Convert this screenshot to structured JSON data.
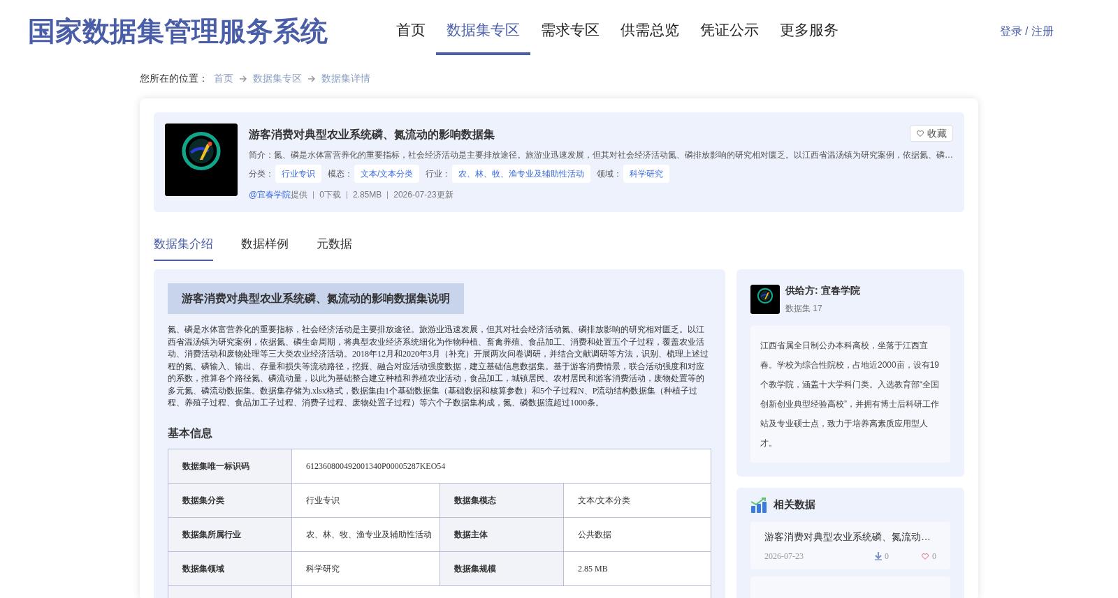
{
  "header": {
    "site_title": "国家数据集管理服务系统",
    "nav": [
      {
        "label": "首页",
        "selected": false
      },
      {
        "label": "数据集专区",
        "selected": true
      },
      {
        "label": "需求专区",
        "selected": false
      },
      {
        "label": "供需总览",
        "selected": false
      },
      {
        "label": "凭证公示",
        "selected": false
      },
      {
        "label": "更多服务",
        "selected": false
      }
    ],
    "login": "登录 / 注册"
  },
  "breadcrumb": {
    "label": "您所在的位置：",
    "items": [
      "首页",
      "数据集专区",
      "数据集详情"
    ]
  },
  "dataset": {
    "title": "游客消费对典型农业系统磷、氮流动的影响数据集",
    "favorite": "收藏",
    "summary": "简介：氮、磷是水体富营养化的重要指标，社会经济活动是主要排放途径。旅游业迅速发展，但其对社会经济活动氮、磷排放影响的研究相对匮乏。以江西省温汤镇为研究案例，依据氮、磷…",
    "tags": [
      {
        "label": "分类：",
        "value": "行业专识"
      },
      {
        "label": "模态：",
        "value": "文本/文本分类"
      },
      {
        "label": "行业：",
        "value": "农、林、牧、渔专业及辅助性活动"
      },
      {
        "label": "领域：",
        "value": "科学研究"
      }
    ],
    "provider": "@宜春学院",
    "provider_suffix": "提供",
    "meta": [
      "0下载",
      "2.85MB",
      "2026-07-23更新"
    ]
  },
  "tabs": [
    {
      "label": "数据集介绍",
      "selected": true
    },
    {
      "label": "数据样例",
      "selected": false
    },
    {
      "label": "元数据",
      "selected": false
    }
  ],
  "description": {
    "heading": "游客消费对典型农业系统磷、氮流动的影响数据集说明",
    "body": "氮、磷是水体富营养化的重要指标，社会经济活动是主要排放途径。旅游业迅速发展，但其对社会经济活动氮、磷排放影响的研究相对匮乏。以江西省温汤镇为研究案例，依据氮、磷生命周期，将典型农业经济系统细化为作物种植、畜禽养殖、食品加工、消费和处置五个子过程，覆盖农业活动、消费活动和废物处理等三大类农业经济活动。2018年12月和2020年3月（补充）开展两次问卷调研，并结合文献调研等方法，识别、梳理上述过程的氮、磷输入、输出、存量和损失等流动路径，挖掘、融合对应活动强度数据，建立基础信息数据集。基于游客消费情景，联合活动强度和对应的系数，推算各个路径氮、磷流动量，以此为基础整合建立种植和养殖农业活动，食品加工，城镇居民、农村居民和游客消费活动，废物处置等的多元氮、磷流动数据集。数据集存储为.xlsx格式，数据集由1个基础数据集（基础数据和核算参数）和5个子过程N、P流动结构数据集（种植子过程、养殖子过程、食品加工子过程、消费子过程、废物处置子过程）等六个子数据集构成，氮、磷数据流超过1000条。"
  },
  "basic_info": {
    "heading": "基本信息",
    "rows": [
      [
        {
          "label": "数据集唯一标识码",
          "value": "612360800492001340P00005287KEO54"
        }
      ],
      [
        {
          "label": "数据集分类",
          "value": "行业专识"
        },
        {
          "label": "数据集模态",
          "value": "文本/文本分类"
        }
      ],
      [
        {
          "label": "数据集所属行业",
          "value": "农、林、牧、渔专业及辅助性活动"
        },
        {
          "label": "数据主体",
          "value": "公共数据"
        }
      ],
      [
        {
          "label": "数据集领域",
          "value": "科学研究"
        },
        {
          "label": "数据集规模",
          "value": "2.85 MB"
        }
      ]
    ]
  },
  "supplier": {
    "name": "供给方: 宜春学院",
    "count": "数据集 17",
    "intro": "江西省属全日制公办本科高校，坐落于江西宜春。学校为综合性院校，占地近2000亩，设有19个教学院，涵盖十大学科门类。入选教育部“全国创新创业典型经验高校”，并拥有博士后科研工作站及专业硕士点，致力于培养高素质应用型人才。"
  },
  "related": {
    "heading": "相关数据",
    "items": [
      {
        "title": "游客消费对典型农业系统磷、氮流动…",
        "date": "2026-07-23",
        "downloads": "0",
        "likes": "0"
      }
    ]
  }
}
